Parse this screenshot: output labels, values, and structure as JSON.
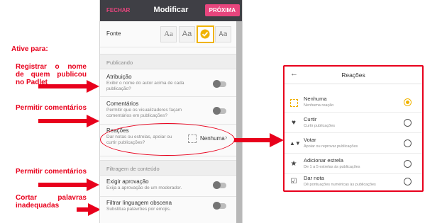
{
  "annotations": {
    "ative_para": "Ative para:",
    "registrar": [
      "Registrar o nome",
      "de quem publicou",
      "no Padlet"
    ],
    "permitir_1": "Permitir comentários",
    "permitir_2": "Permitir comentários",
    "cortar": [
      "Cortar palavras",
      "inadequadas"
    ],
    "color": "#e8001c"
  },
  "phone": {
    "close": "FECHAR",
    "title": "Modificar",
    "next": "PRÓXIMA",
    "font_label": "Fonte",
    "font_options": [
      "Aa",
      "Aa",
      "Aa",
      "Aa"
    ],
    "font_selected_index": 2,
    "section_publicando": "Publicando",
    "atribuicao": {
      "label": "Atribuição",
      "desc": "Exibir o nome do autor acima de cada publicação?"
    },
    "comentarios": {
      "label": "Comentários",
      "desc": "Permitir que os visualizadores façam comentários em publicações?"
    },
    "reacoes": {
      "label": "Reações",
      "desc": "Dar notas ou estrelas, apoiar ou curtir publicações?",
      "value": "Nenhuma"
    },
    "section_filtragem": "Filtragem de conteúdo",
    "exigir": {
      "label": "Exigir aprovação",
      "desc": "Exija a aprovação de um moderador."
    },
    "filtrar": {
      "label": "Filtrar linguagem obscena",
      "desc": "Substitua palavrões por emojis."
    },
    "accent": "#e8457d",
    "header_bg": "#3f3f45"
  },
  "reactions_panel": {
    "title": "Reações",
    "back_icon": "arrow-left-icon",
    "selected_index": 0,
    "options": [
      {
        "label": "Nenhuma",
        "desc": "Nenhuma reação",
        "icon": "square-dashed-icon"
      },
      {
        "label": "Curtir",
        "desc": "Curtir publicações",
        "icon": "heart-icon"
      },
      {
        "label": "Votar",
        "desc": "Apoiar ou reprovar publicações",
        "icon": "thumbs-icon"
      },
      {
        "label": "Adicionar estrela",
        "desc": "De 1 a 5 estrelas às publicações",
        "icon": "star-icon"
      },
      {
        "label": "Dar nota",
        "desc": "Dê pontuações numéricas às publicações",
        "icon": "checkbox-icon"
      }
    ],
    "highlight": "#f0b300"
  }
}
